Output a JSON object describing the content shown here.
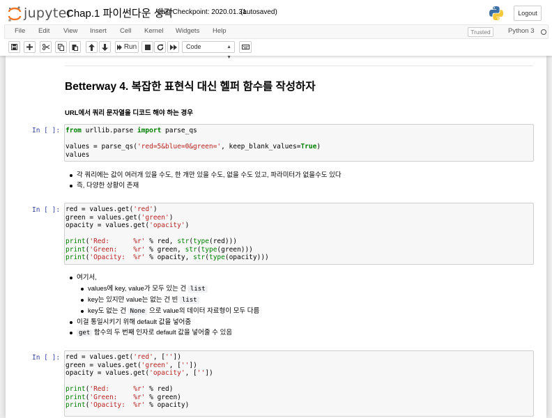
{
  "header": {
    "logo_text": "jupyter",
    "title": "Chap.1 파이썬다운 생각",
    "checkpoint": "Last Checkpoint: 2020.01.31",
    "autosaved": "(autosaved)",
    "logout_label": "Logout"
  },
  "menu": {
    "items": [
      "File",
      "Edit",
      "View",
      "Insert",
      "Cell",
      "Kernel",
      "Widgets",
      "Help"
    ],
    "trusted": "Trusted",
    "kernel": "Python 3"
  },
  "toolbar": {
    "run_label": "Run",
    "cell_type": "Code",
    "icons": [
      "save-icon",
      "plus-icon",
      "cut-icon",
      "copy-icon",
      "paste-icon",
      "arrow-up-icon",
      "arrow-down-icon",
      "run-icon",
      "stop-icon",
      "restart-icon",
      "fast-forward-icon",
      "keyboard-icon"
    ]
  },
  "notebook": {
    "heading": "Betterway 4. 복잡한 표현식 대신 헬퍼 함수를 작성하자",
    "subheading": "URL에서 쿼리 문자열을 디코드 해야 하는 경우",
    "prompt": "In [ ]:",
    "cell1": [
      "from urllib.parse import parse_qs",
      "",
      "values = parse_qs('red=5&blue=0&green=', keep_blank_values=True)",
      "values"
    ],
    "bullets1": [
      "각 쿼리에는 값이 여러개 있을 수도, 한 개만 있을 수도, 없을 수도 있고, 파라미터가 없을수도 있다",
      "즉, 다양한 상황이 존재"
    ],
    "cell2": [
      "red = values.get('red')",
      "green = values.get('green')",
      "opacity = values.get('opacity')",
      "",
      "print('Red:      %r' % red, str(type(red)))",
      "print('Green:    %r' % green, str(type(green)))",
      "print('Opacity:  %r' % opacity, str(type(opacity)))"
    ],
    "bullets2": {
      "lead": "여기서,",
      "sub": [
        {
          "pre": "values에 key, value가 모두 있는 건",
          "code": "list",
          "post": ""
        },
        {
          "pre": "key는 있지만 value는 없는 건 빈",
          "code": "list",
          "post": ""
        },
        {
          "pre": "key도 없는 건",
          "code": "None",
          "post": "으로 value의 데이터 자료형이 모두 다름"
        }
      ]
    },
    "bullets3": [
      {
        "pre": "",
        "code": "",
        "post": "이걸 통일시키기 위해 default 값을 넣어줌"
      },
      {
        "pre": "",
        "code": "get",
        "post": "함수의 두 번째 인자로 default 값을 넣어줄 수 있음"
      }
    ],
    "cell3": [
      "red = values.get('red', [''])",
      "green = values.get('green', [''])",
      "opacity = values.get('opacity', [''])",
      "",
      "print('Red:      %r' % red)",
      "print('Green:    %r' % green)",
      "print('Opacity:  %r' % opacity)"
    ]
  }
}
